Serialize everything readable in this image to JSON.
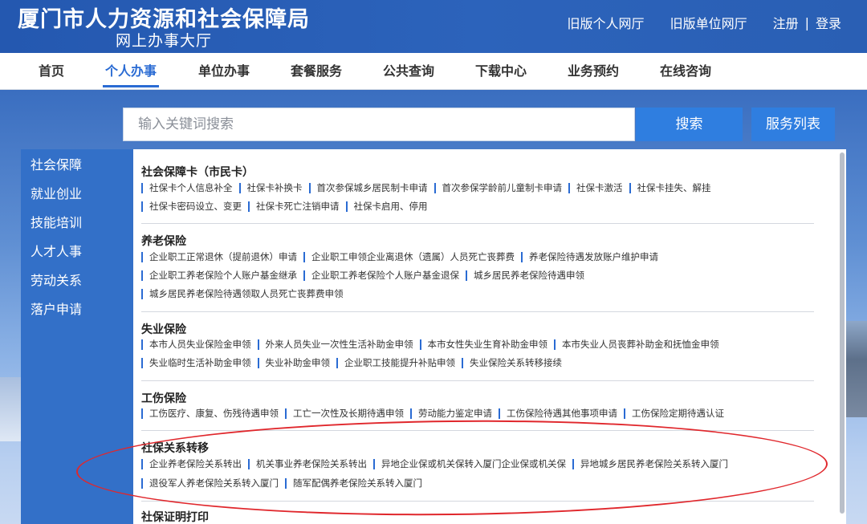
{
  "header": {
    "title": "厦门市人力资源和社会保障局",
    "subtitle": "网上办事大厅",
    "links": [
      "旧版个人网厅",
      "旧版单位网厅",
      "注册",
      "|",
      "登录"
    ]
  },
  "nav": {
    "items": [
      "首页",
      "个人办事",
      "单位办事",
      "套餐服务",
      "公共查询",
      "下载中心",
      "业务预约",
      "在线咨询"
    ],
    "active": "个人办事"
  },
  "search": {
    "placeholder": "输入关键词搜索",
    "button": "搜索",
    "list_button": "服务列表"
  },
  "sidebar": {
    "items": [
      "社会保障",
      "就业创业",
      "技能培训",
      "人才人事",
      "劳动关系",
      "落户申请"
    ]
  },
  "sections": [
    {
      "title": "社会保障卡（市民卡）",
      "rows": [
        [
          "社保卡个人信息补全",
          "社保卡补换卡",
          "首次参保城乡居民制卡申请",
          "首次参保学龄前儿童制卡申请",
          "社保卡激活",
          "社保卡挂失、解挂"
        ],
        [
          "社保卡密码设立、变更",
          "社保卡死亡注销申请",
          "社保卡启用、停用"
        ]
      ]
    },
    {
      "title": "养老保险",
      "rows": [
        [
          "企业职工正常退休（提前退休）申请",
          "企业职工申领企业离退休（遗属）人员死亡丧葬费",
          "养老保险待遇发放账户维护申请"
        ],
        [
          "企业职工养老保险个人账户基金继承",
          "企业职工养老保险个人账户基金退保",
          "城乡居民养老保险待遇申领"
        ],
        [
          "城乡居民养老保险待遇领取人员死亡丧葬费申领"
        ]
      ]
    },
    {
      "title": "失业保险",
      "rows": [
        [
          "本市人员失业保险金申领",
          "外来人员失业一次性生活补助金申领",
          "本市女性失业生育补助金申领",
          "本市失业人员丧葬补助金和抚恤金申领"
        ],
        [
          "失业临时生活补助金申领",
          "失业补助金申领",
          "企业职工技能提升补贴申领",
          "失业保险关系转移接续"
        ]
      ]
    },
    {
      "title": "工伤保险",
      "rows": [
        [
          "工伤医疗、康复、伤残待遇申领",
          "工亡一次性及长期待遇申领",
          "劳动能力鉴定申请",
          "工伤保险待遇其他事项申请",
          "工伤保险定期待遇认证"
        ]
      ]
    },
    {
      "title": "社保关系转移",
      "rows": [
        [
          "企业养老保险关系转出",
          "机关事业养老保险关系转出",
          "异地企业保或机关保转入厦门企业保或机关保",
          "异地城乡居民养老保险关系转入厦门"
        ],
        [
          "退役军人养老保险关系转入厦门",
          "随军配偶养老保险关系转入厦门"
        ]
      ]
    },
    {
      "title": "社保证明打印",
      "rows": []
    }
  ],
  "colors": {
    "brand_blue": "#2a6bd3",
    "header_blue": "#2c63bb",
    "annotation_red": "#e0272c"
  }
}
